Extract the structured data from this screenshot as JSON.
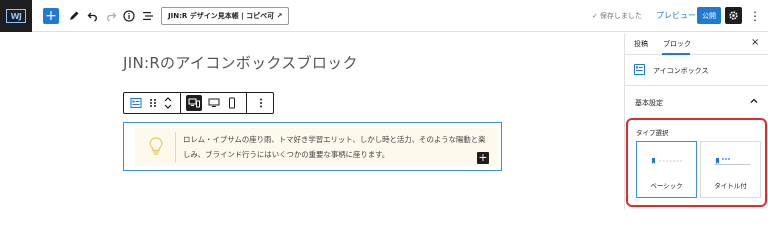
{
  "app": {
    "logo_text": "WJ"
  },
  "topbar": {
    "add_label": "+",
    "doc_title": "JIN:R デザイン見本帳 | コピペ可 ↗",
    "saved_text": "保存しました",
    "preview_label": "プレビュー",
    "publish_label": "公開",
    "more_label": "⋮"
  },
  "editor": {
    "post_title": "JIN:Rのアイコンボックスブロック",
    "icon_box": {
      "text": "ロレム・イプサムの座り雨、トマ好き学習エリット、しかし時と活力、そのような陽動と楽しみ、ブラインド行うにはいくつかの重要な事柄に座ります。",
      "append_label": "+"
    }
  },
  "sidebar": {
    "tabs": [
      {
        "label": "投稿"
      },
      {
        "label": "ブロック"
      }
    ],
    "close_label": "×",
    "block_name": "アイコンボックス",
    "section_label": "基本設定",
    "type_select": {
      "label": "タイプ選択",
      "options": [
        {
          "label": "ベーシック",
          "selected": true
        },
        {
          "label": "タイトル付",
          "selected": false
        }
      ]
    }
  },
  "colors": {
    "accent": "#1e7ad3",
    "highlight_border": "#e02c2c",
    "icon_box_bg": "#fdf9ec",
    "icon_box_border": "#3d8fd6"
  }
}
